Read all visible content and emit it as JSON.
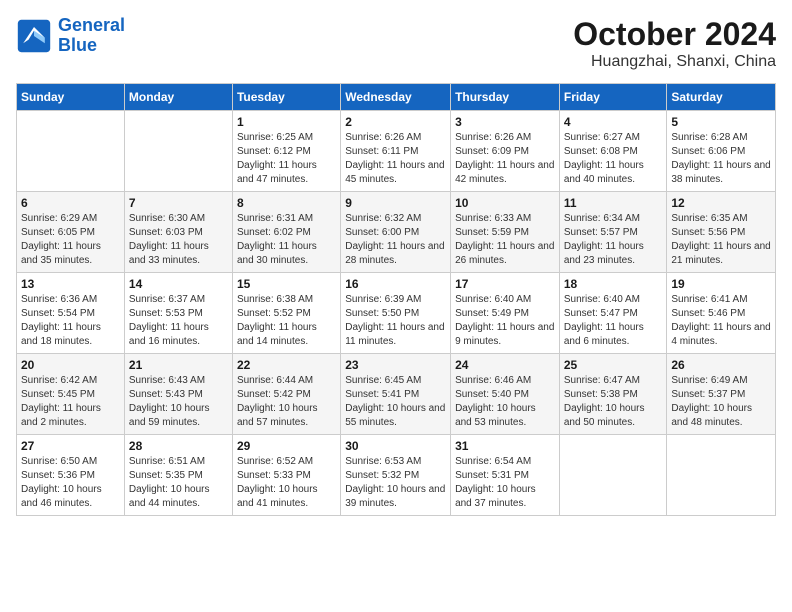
{
  "header": {
    "logo_line1": "General",
    "logo_line2": "Blue",
    "month": "October 2024",
    "location": "Huangzhai, Shanxi, China"
  },
  "days_of_week": [
    "Sunday",
    "Monday",
    "Tuesday",
    "Wednesday",
    "Thursday",
    "Friday",
    "Saturday"
  ],
  "weeks": [
    [
      {
        "day": "",
        "info": ""
      },
      {
        "day": "",
        "info": ""
      },
      {
        "day": "1",
        "info": "Sunrise: 6:25 AM\nSunset: 6:12 PM\nDaylight: 11 hours and 47 minutes."
      },
      {
        "day": "2",
        "info": "Sunrise: 6:26 AM\nSunset: 6:11 PM\nDaylight: 11 hours and 45 minutes."
      },
      {
        "day": "3",
        "info": "Sunrise: 6:26 AM\nSunset: 6:09 PM\nDaylight: 11 hours and 42 minutes."
      },
      {
        "day": "4",
        "info": "Sunrise: 6:27 AM\nSunset: 6:08 PM\nDaylight: 11 hours and 40 minutes."
      },
      {
        "day": "5",
        "info": "Sunrise: 6:28 AM\nSunset: 6:06 PM\nDaylight: 11 hours and 38 minutes."
      }
    ],
    [
      {
        "day": "6",
        "info": "Sunrise: 6:29 AM\nSunset: 6:05 PM\nDaylight: 11 hours and 35 minutes."
      },
      {
        "day": "7",
        "info": "Sunrise: 6:30 AM\nSunset: 6:03 PM\nDaylight: 11 hours and 33 minutes."
      },
      {
        "day": "8",
        "info": "Sunrise: 6:31 AM\nSunset: 6:02 PM\nDaylight: 11 hours and 30 minutes."
      },
      {
        "day": "9",
        "info": "Sunrise: 6:32 AM\nSunset: 6:00 PM\nDaylight: 11 hours and 28 minutes."
      },
      {
        "day": "10",
        "info": "Sunrise: 6:33 AM\nSunset: 5:59 PM\nDaylight: 11 hours and 26 minutes."
      },
      {
        "day": "11",
        "info": "Sunrise: 6:34 AM\nSunset: 5:57 PM\nDaylight: 11 hours and 23 minutes."
      },
      {
        "day": "12",
        "info": "Sunrise: 6:35 AM\nSunset: 5:56 PM\nDaylight: 11 hours and 21 minutes."
      }
    ],
    [
      {
        "day": "13",
        "info": "Sunrise: 6:36 AM\nSunset: 5:54 PM\nDaylight: 11 hours and 18 minutes."
      },
      {
        "day": "14",
        "info": "Sunrise: 6:37 AM\nSunset: 5:53 PM\nDaylight: 11 hours and 16 minutes."
      },
      {
        "day": "15",
        "info": "Sunrise: 6:38 AM\nSunset: 5:52 PM\nDaylight: 11 hours and 14 minutes."
      },
      {
        "day": "16",
        "info": "Sunrise: 6:39 AM\nSunset: 5:50 PM\nDaylight: 11 hours and 11 minutes."
      },
      {
        "day": "17",
        "info": "Sunrise: 6:40 AM\nSunset: 5:49 PM\nDaylight: 11 hours and 9 minutes."
      },
      {
        "day": "18",
        "info": "Sunrise: 6:40 AM\nSunset: 5:47 PM\nDaylight: 11 hours and 6 minutes."
      },
      {
        "day": "19",
        "info": "Sunrise: 6:41 AM\nSunset: 5:46 PM\nDaylight: 11 hours and 4 minutes."
      }
    ],
    [
      {
        "day": "20",
        "info": "Sunrise: 6:42 AM\nSunset: 5:45 PM\nDaylight: 11 hours and 2 minutes."
      },
      {
        "day": "21",
        "info": "Sunrise: 6:43 AM\nSunset: 5:43 PM\nDaylight: 10 hours and 59 minutes."
      },
      {
        "day": "22",
        "info": "Sunrise: 6:44 AM\nSunset: 5:42 PM\nDaylight: 10 hours and 57 minutes."
      },
      {
        "day": "23",
        "info": "Sunrise: 6:45 AM\nSunset: 5:41 PM\nDaylight: 10 hours and 55 minutes."
      },
      {
        "day": "24",
        "info": "Sunrise: 6:46 AM\nSunset: 5:40 PM\nDaylight: 10 hours and 53 minutes."
      },
      {
        "day": "25",
        "info": "Sunrise: 6:47 AM\nSunset: 5:38 PM\nDaylight: 10 hours and 50 minutes."
      },
      {
        "day": "26",
        "info": "Sunrise: 6:49 AM\nSunset: 5:37 PM\nDaylight: 10 hours and 48 minutes."
      }
    ],
    [
      {
        "day": "27",
        "info": "Sunrise: 6:50 AM\nSunset: 5:36 PM\nDaylight: 10 hours and 46 minutes."
      },
      {
        "day": "28",
        "info": "Sunrise: 6:51 AM\nSunset: 5:35 PM\nDaylight: 10 hours and 44 minutes."
      },
      {
        "day": "29",
        "info": "Sunrise: 6:52 AM\nSunset: 5:33 PM\nDaylight: 10 hours and 41 minutes."
      },
      {
        "day": "30",
        "info": "Sunrise: 6:53 AM\nSunset: 5:32 PM\nDaylight: 10 hours and 39 minutes."
      },
      {
        "day": "31",
        "info": "Sunrise: 6:54 AM\nSunset: 5:31 PM\nDaylight: 10 hours and 37 minutes."
      },
      {
        "day": "",
        "info": ""
      },
      {
        "day": "",
        "info": ""
      }
    ]
  ]
}
